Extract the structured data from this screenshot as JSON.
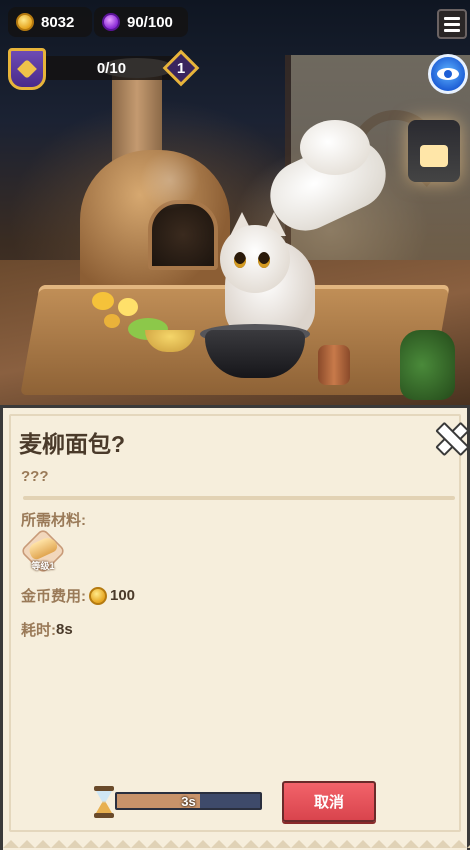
{
  "hud": {
    "coins": "8032",
    "gems": "90/100",
    "quest_progress": "0/10",
    "level": "1"
  },
  "recipe": {
    "title": "麦柳面包?",
    "description": "???",
    "materials_label": "所需材料:",
    "material_item": {
      "name": "bread-icon",
      "count": "等级1"
    },
    "cost_label": "金币费用:",
    "cost_value": "100",
    "time_label": "耗时:",
    "time_value": "8s"
  },
  "cooking": {
    "timer": "3s",
    "progress_fraction": 0.58,
    "cancel_label": "取消"
  },
  "colors": {
    "cancel": "#d9444d",
    "progress_fill": "#c8936a",
    "progress_track": "#3e4a6a",
    "panel_bg": "#f6eedc"
  },
  "icons": {
    "coin": "coin-icon",
    "gem": "gem-icon",
    "menu": "hamburger-menu-icon",
    "eye": "eye-icon",
    "close": "close-icon",
    "hourglass": "hourglass-icon"
  }
}
